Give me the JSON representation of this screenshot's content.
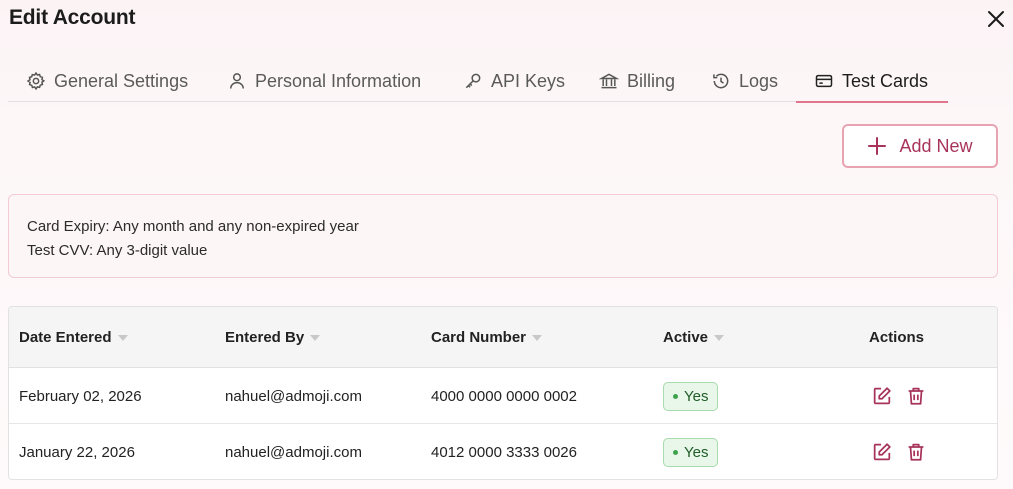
{
  "dialog": {
    "title": "Edit Account",
    "close_icon": "close-icon"
  },
  "tabs": [
    {
      "label": "General Settings",
      "icon": "gear-icon",
      "active": false
    },
    {
      "label": "Personal Information",
      "icon": "user-icon",
      "active": false
    },
    {
      "label": "API Keys",
      "icon": "key-icon",
      "active": false
    },
    {
      "label": "Billing",
      "icon": "bank-icon",
      "active": false
    },
    {
      "label": "Logs",
      "icon": "history-icon",
      "active": false
    },
    {
      "label": "Test Cards",
      "icon": "credit-card-icon",
      "active": true
    }
  ],
  "toolbar": {
    "add_label": "Add New",
    "add_icon": "plus-icon"
  },
  "info": {
    "line1": "Card Expiry: Any month and any non-expired year",
    "line2": "Test CVV: Any 3-digit value"
  },
  "table": {
    "columns": [
      "Date Entered",
      "Entered By",
      "Card Number",
      "Active",
      "Actions"
    ],
    "rows": [
      {
        "date": "February 02, 2026",
        "by": "nahuel@admoji.com",
        "card": "4000 0000 0000 0002",
        "active": "Yes"
      },
      {
        "date": "January 22, 2026",
        "by": "nahuel@admoji.com",
        "card": "4012 0000 3333 0026",
        "active": "Yes"
      }
    ]
  },
  "colors": {
    "accent": "#a8335a",
    "tab_underline": "#e0758d",
    "active_badge_bg": "#e8f7e9",
    "active_badge_dot": "#3fa34d"
  }
}
